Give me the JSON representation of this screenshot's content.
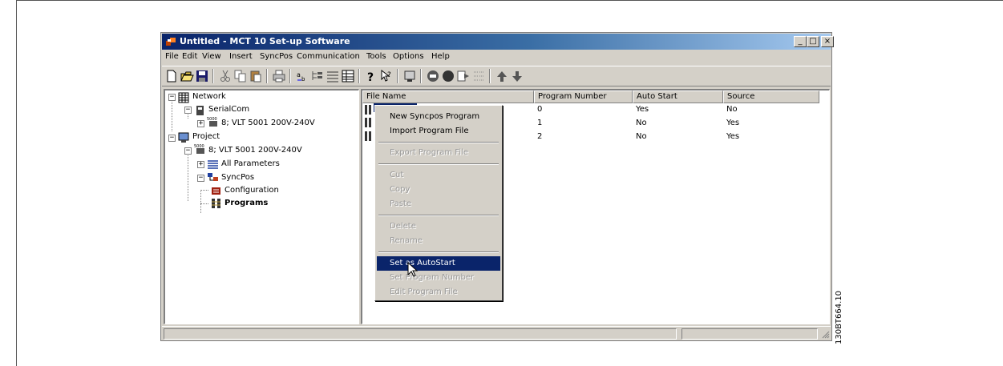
{
  "window": {
    "title": "Untitled - MCT 10 Set-up Software",
    "controls": {
      "minimize": "_",
      "maximize": "□",
      "close": "×"
    }
  },
  "menu": [
    "File",
    "Edit",
    "View",
    "Insert",
    "SyncPos",
    "Communication",
    "Tools",
    "Options",
    "Help"
  ],
  "tree": {
    "network": "Network",
    "serialcom": "SerialCom",
    "serial_device": "8; VLT 5001 200V-240V",
    "project": "Project",
    "project_device": "8; VLT 5001 200V-240V",
    "all_parameters": "All Parameters",
    "syncpos": "SyncPos",
    "configuration": "Configuration",
    "programs": "Programs"
  },
  "list": {
    "columns": [
      "File Name",
      "Program Number",
      "Auto Start",
      "Source"
    ],
    "rows": [
      {
        "file": "",
        "number": "0",
        "auto": "Yes",
        "source": "No"
      },
      {
        "file": "",
        "number": "1",
        "auto": "No",
        "source": "Yes"
      },
      {
        "file": "",
        "number": "2",
        "auto": "No",
        "source": "Yes"
      }
    ]
  },
  "context_menu": {
    "new_program": "New Syncpos Program",
    "import": "Import Program File",
    "export": "Export Program File",
    "cut": "Cut",
    "copy": "Copy",
    "paste": "Paste",
    "delete": "Delete",
    "rename": "Rename",
    "set_autostart": "Set as AutoStart",
    "set_number": "Set Program Number",
    "edit": "Edit Program File"
  },
  "figure_code": "130BT664.10",
  "colors": {
    "titlebar_start": "#0a246a",
    "titlebar_end": "#a6caf0",
    "highlight": "#0a246a",
    "face": "#d4d0c8"
  }
}
